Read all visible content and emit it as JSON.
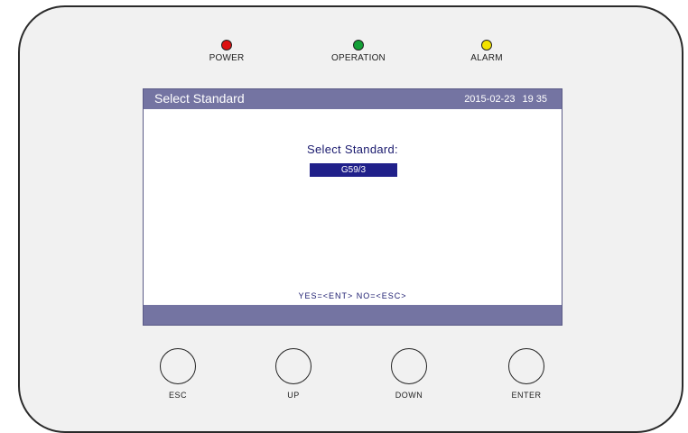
{
  "leds": [
    {
      "label": "POWER",
      "color": "#dd1111"
    },
    {
      "label": "OPERATION",
      "color": "#13a036"
    },
    {
      "label": "ALARM",
      "color": "#f3e300"
    }
  ],
  "screen": {
    "title": "Select Standard",
    "date": "2015-02-23",
    "time": "19 35",
    "prompt": "Select Standard:",
    "selected_value": "G59/3",
    "hint": "YES=<ENT>  NO=<ESC>"
  },
  "buttons": [
    {
      "label": "ESC"
    },
    {
      "label": "UP"
    },
    {
      "label": "DOWN"
    },
    {
      "label": "ENTER"
    }
  ],
  "colors": {
    "screen_bar": "#7474a2",
    "selection_bg": "#20208a",
    "screen_text": "#1a1a6e"
  }
}
